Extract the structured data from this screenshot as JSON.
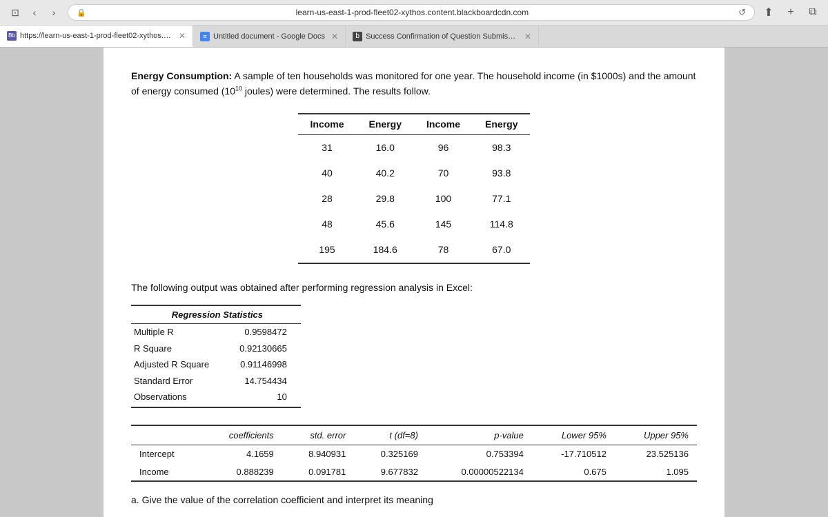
{
  "browser": {
    "address": "learn-us-east-1-prod-fleet02-xythos.content.blackboardcdn.com",
    "reload_icon": "↺",
    "nav_back": "<",
    "nav_forward": ">",
    "nav_tabs_icon": "⊡",
    "share_icon": "⬆",
    "add_tab_icon": "+",
    "windows_icon": "⧉"
  },
  "tabs": [
    {
      "label": "https://learn-us-east-1-prod-fleet02-xythos.content.blackboardcdn.com/5fca...",
      "favicon_color": "#5a5aab",
      "favicon_text": "Bb",
      "active": true
    },
    {
      "label": "Untitled document - Google Docs",
      "favicon_color": "#4285f4",
      "favicon_text": "≡",
      "active": false
    },
    {
      "label": "Success Confirmation of Question Submission | bartleby",
      "favicon_color": "#333",
      "favicon_text": "b",
      "active": false
    }
  ],
  "problem": {
    "title": "Energy Consumption:",
    "description": "A sample of ten households was monitored for one year.  The household income (in $1000s) and the amount of energy consumed (10",
    "exponent": "10",
    "description2": " joules) were determined.  The results follow.",
    "table_headers": [
      "Income",
      "Energy",
      "Income",
      "Energy"
    ],
    "table_rows": [
      [
        "31",
        "16.0",
        "96",
        "98.3"
      ],
      [
        "40",
        "40.2",
        "70",
        "93.8"
      ],
      [
        "28",
        "29.8",
        "100",
        "77.1"
      ],
      [
        "48",
        "45.6",
        "145",
        "114.8"
      ],
      [
        "195",
        "184.6",
        "78",
        "67.0"
      ]
    ]
  },
  "regression": {
    "intro": "The following output was obtained after performing regression analysis in Excel:",
    "stats_title": "Regression Statistics",
    "stats_rows": [
      [
        "Multiple R",
        "0.9598472"
      ],
      [
        "R Square",
        "0.92130665"
      ],
      [
        "Adjusted R Square",
        "0.91146998"
      ],
      [
        "Standard Error",
        "14.754434"
      ],
      [
        "Observations",
        "10"
      ]
    ],
    "coeff_headers": [
      "",
      "coefficients",
      "std. error",
      "t (df=8)",
      "p-value",
      "Lower 95%",
      "Upper 95%"
    ],
    "coeff_rows": [
      [
        "Intercept",
        "4.1659",
        "8.940931",
        "0.325169",
        "0.753394",
        "-17.710512",
        "23.525136"
      ],
      [
        "Income",
        "0.888239",
        "0.091781",
        "9.677832",
        "0.00000522134",
        "0.675",
        "1.095"
      ]
    ]
  },
  "question_line": "a.  Give the value of the correlation coefficient and interpret its meaning"
}
